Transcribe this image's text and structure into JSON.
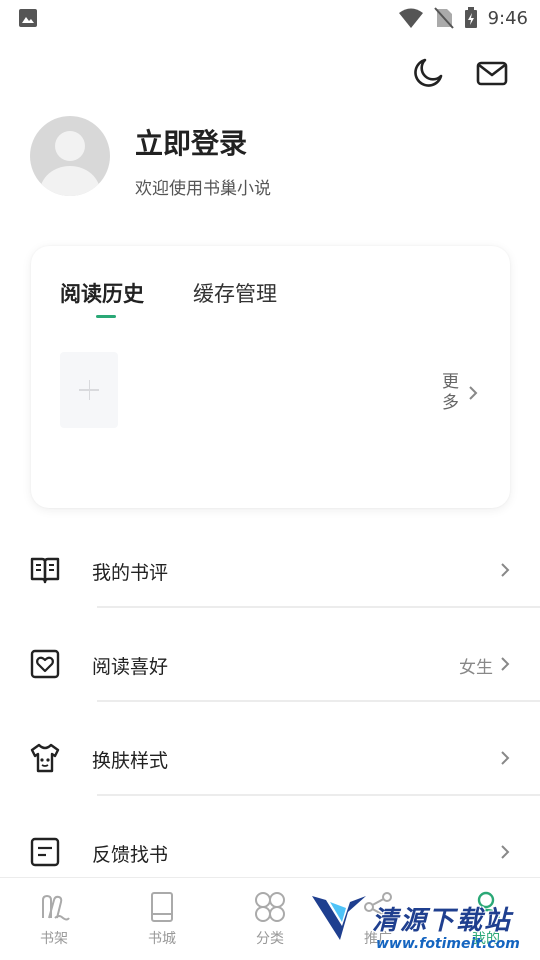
{
  "status_bar": {
    "time": "9:46"
  },
  "profile": {
    "login_title": "立即登录",
    "welcome_text": "欢迎使用书巢小说"
  },
  "card": {
    "tabs": [
      {
        "label": "阅读历史",
        "active": true
      },
      {
        "label": "缓存管理",
        "active": false
      }
    ],
    "more_label": "更多"
  },
  "menu": {
    "items": [
      {
        "label": "我的书评",
        "value": "",
        "icon": "book-review-icon"
      },
      {
        "label": "阅读喜好",
        "value": "女生",
        "icon": "heart-box-icon"
      },
      {
        "label": "换肤样式",
        "value": "",
        "icon": "tshirt-icon"
      },
      {
        "label": "反馈找书",
        "value": "",
        "icon": "feedback-icon"
      }
    ]
  },
  "bottom_nav": {
    "items": [
      {
        "label": "书架",
        "icon": "bookshelf-icon",
        "active": false
      },
      {
        "label": "书城",
        "icon": "book-icon",
        "active": false
      },
      {
        "label": "分类",
        "icon": "category-icon",
        "active": false
      },
      {
        "label": "推广",
        "icon": "share-icon",
        "active": false
      },
      {
        "label": "我的",
        "icon": "person-icon",
        "active": true
      }
    ]
  },
  "watermark": {
    "text": "清源下载站",
    "url": "www.fotimeit.com"
  },
  "colors": {
    "accent": "#2aa876",
    "text_primary": "#222222",
    "text_secondary": "#888888"
  }
}
